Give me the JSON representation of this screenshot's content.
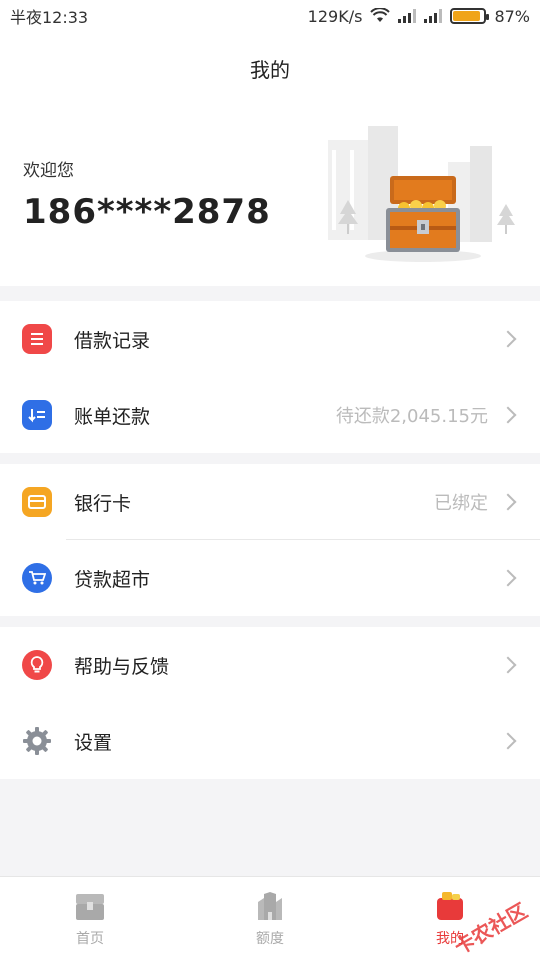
{
  "status": {
    "time": "半夜12:33",
    "speed": "129K/s",
    "battery": "87%",
    "battery_level": 0.87
  },
  "nav": {
    "title": "我的"
  },
  "header": {
    "welcome": "欢迎您",
    "phone": "186****2878"
  },
  "group1": {
    "loan_records": {
      "label": "借款记录",
      "value": ""
    },
    "bill_repay": {
      "label": "账单还款",
      "value": "待还款2,045.15元"
    }
  },
  "group2": {
    "bank_card": {
      "label": "银行卡",
      "value": "已绑定"
    },
    "loan_market": {
      "label": "贷款超市",
      "value": ""
    }
  },
  "group3": {
    "help": {
      "label": "帮助与反馈",
      "value": ""
    },
    "settings": {
      "label": "设置",
      "value": ""
    }
  },
  "tabs": [
    {
      "label": "首页",
      "icon": "home-chest-icon"
    },
    {
      "label": "额度",
      "icon": "building-icon"
    },
    {
      "label": "我的",
      "icon": "profile-gift-icon"
    }
  ],
  "watermark": "卡农社区",
  "colors": {
    "accent": "#e83a3a",
    "blue": "#2f6fe6",
    "orange": "#f5a623",
    "battery": "#f0a419"
  }
}
